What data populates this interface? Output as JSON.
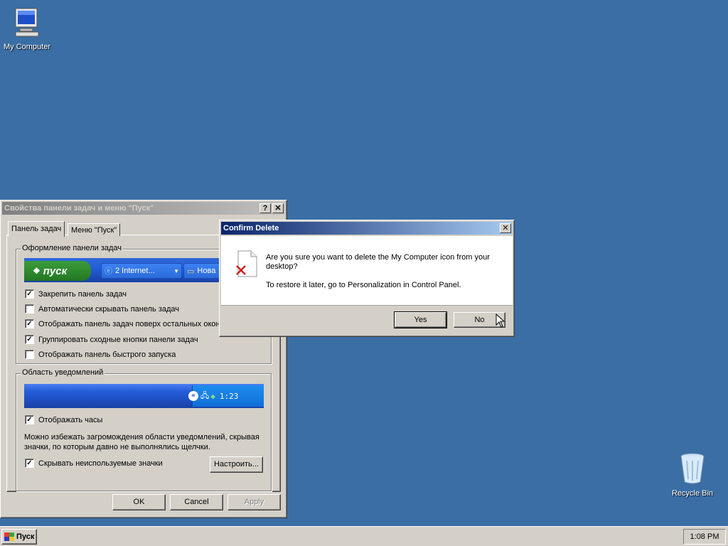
{
  "desktop": {
    "my_computer_label": "My Computer",
    "recycle_bin_label": "Recycle Bin"
  },
  "taskbar_props": {
    "title": "Свойства панели задач и меню \"Пуск\"",
    "help_btn": "?",
    "close_btn": "✕",
    "tabs": [
      "Панель задач",
      "Меню \"Пуск\""
    ],
    "appearance_group": "Оформление панели задач",
    "preview_start": "пуск",
    "preview_task1": "2 Internet...",
    "preview_task2": "Нова",
    "options": [
      {
        "label": "Закрепить панель задач",
        "checked": true
      },
      {
        "label": "Автоматически скрывать панель задач",
        "checked": false
      },
      {
        "label": "Отображать панель задач поверх остальных окон",
        "checked": true
      },
      {
        "label": "Группировать сходные кнопки панели задач",
        "checked": true
      },
      {
        "label": "Отображать панель быстрого запуска",
        "checked": false
      }
    ],
    "notify_group": "Область уведомлений",
    "tray_time": "1:23",
    "show_clock": "Отображать часы",
    "hint": "Можно избежать загромождения области уведомлений, скрывая значки, по которым давно не выполнялись щелчки.",
    "hide_icons": "Скрывать неиспользуемые значки",
    "customize": "Настроить...",
    "ok": "OK",
    "cancel": "Cancel",
    "apply": "Apply"
  },
  "confirm": {
    "title": "Confirm Delete",
    "message": "Are you sure you want to delete the My Computer icon from your desktop?",
    "restore": "To restore it later, go to Personalization in Control Panel.",
    "yes": "Yes",
    "no": "No"
  },
  "taskbar": {
    "start": "Пуск",
    "clock": "1:08 PM"
  },
  "colors": {
    "desktop": "#3a6ea5",
    "active_title": "#0a246a",
    "face": "#d4d0c8"
  }
}
